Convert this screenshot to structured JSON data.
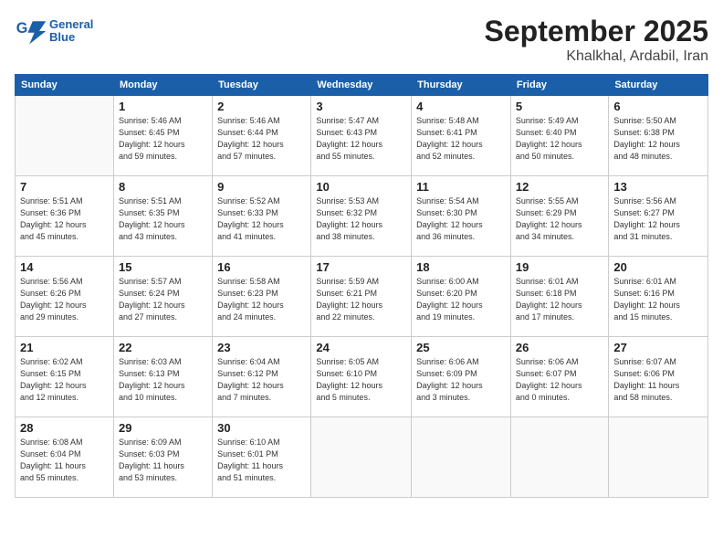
{
  "logo": {
    "text_general": "General",
    "text_blue": "Blue"
  },
  "header": {
    "month": "September 2025",
    "location": "Khalkhal, Ardabil, Iran"
  },
  "weekdays": [
    "Sunday",
    "Monday",
    "Tuesday",
    "Wednesday",
    "Thursday",
    "Friday",
    "Saturday"
  ],
  "weeks": [
    [
      {
        "day": "",
        "details": ""
      },
      {
        "day": "1",
        "details": "Sunrise: 5:46 AM\nSunset: 6:45 PM\nDaylight: 12 hours\nand 59 minutes."
      },
      {
        "day": "2",
        "details": "Sunrise: 5:46 AM\nSunset: 6:44 PM\nDaylight: 12 hours\nand 57 minutes."
      },
      {
        "day": "3",
        "details": "Sunrise: 5:47 AM\nSunset: 6:43 PM\nDaylight: 12 hours\nand 55 minutes."
      },
      {
        "day": "4",
        "details": "Sunrise: 5:48 AM\nSunset: 6:41 PM\nDaylight: 12 hours\nand 52 minutes."
      },
      {
        "day": "5",
        "details": "Sunrise: 5:49 AM\nSunset: 6:40 PM\nDaylight: 12 hours\nand 50 minutes."
      },
      {
        "day": "6",
        "details": "Sunrise: 5:50 AM\nSunset: 6:38 PM\nDaylight: 12 hours\nand 48 minutes."
      }
    ],
    [
      {
        "day": "7",
        "details": "Sunrise: 5:51 AM\nSunset: 6:36 PM\nDaylight: 12 hours\nand 45 minutes."
      },
      {
        "day": "8",
        "details": "Sunrise: 5:51 AM\nSunset: 6:35 PM\nDaylight: 12 hours\nand 43 minutes."
      },
      {
        "day": "9",
        "details": "Sunrise: 5:52 AM\nSunset: 6:33 PM\nDaylight: 12 hours\nand 41 minutes."
      },
      {
        "day": "10",
        "details": "Sunrise: 5:53 AM\nSunset: 6:32 PM\nDaylight: 12 hours\nand 38 minutes."
      },
      {
        "day": "11",
        "details": "Sunrise: 5:54 AM\nSunset: 6:30 PM\nDaylight: 12 hours\nand 36 minutes."
      },
      {
        "day": "12",
        "details": "Sunrise: 5:55 AM\nSunset: 6:29 PM\nDaylight: 12 hours\nand 34 minutes."
      },
      {
        "day": "13",
        "details": "Sunrise: 5:56 AM\nSunset: 6:27 PM\nDaylight: 12 hours\nand 31 minutes."
      }
    ],
    [
      {
        "day": "14",
        "details": "Sunrise: 5:56 AM\nSunset: 6:26 PM\nDaylight: 12 hours\nand 29 minutes."
      },
      {
        "day": "15",
        "details": "Sunrise: 5:57 AM\nSunset: 6:24 PM\nDaylight: 12 hours\nand 27 minutes."
      },
      {
        "day": "16",
        "details": "Sunrise: 5:58 AM\nSunset: 6:23 PM\nDaylight: 12 hours\nand 24 minutes."
      },
      {
        "day": "17",
        "details": "Sunrise: 5:59 AM\nSunset: 6:21 PM\nDaylight: 12 hours\nand 22 minutes."
      },
      {
        "day": "18",
        "details": "Sunrise: 6:00 AM\nSunset: 6:20 PM\nDaylight: 12 hours\nand 19 minutes."
      },
      {
        "day": "19",
        "details": "Sunrise: 6:01 AM\nSunset: 6:18 PM\nDaylight: 12 hours\nand 17 minutes."
      },
      {
        "day": "20",
        "details": "Sunrise: 6:01 AM\nSunset: 6:16 PM\nDaylight: 12 hours\nand 15 minutes."
      }
    ],
    [
      {
        "day": "21",
        "details": "Sunrise: 6:02 AM\nSunset: 6:15 PM\nDaylight: 12 hours\nand 12 minutes."
      },
      {
        "day": "22",
        "details": "Sunrise: 6:03 AM\nSunset: 6:13 PM\nDaylight: 12 hours\nand 10 minutes."
      },
      {
        "day": "23",
        "details": "Sunrise: 6:04 AM\nSunset: 6:12 PM\nDaylight: 12 hours\nand 7 minutes."
      },
      {
        "day": "24",
        "details": "Sunrise: 6:05 AM\nSunset: 6:10 PM\nDaylight: 12 hours\nand 5 minutes."
      },
      {
        "day": "25",
        "details": "Sunrise: 6:06 AM\nSunset: 6:09 PM\nDaylight: 12 hours\nand 3 minutes."
      },
      {
        "day": "26",
        "details": "Sunrise: 6:06 AM\nSunset: 6:07 PM\nDaylight: 12 hours\nand 0 minutes."
      },
      {
        "day": "27",
        "details": "Sunrise: 6:07 AM\nSunset: 6:06 PM\nDaylight: 11 hours\nand 58 minutes."
      }
    ],
    [
      {
        "day": "28",
        "details": "Sunrise: 6:08 AM\nSunset: 6:04 PM\nDaylight: 11 hours\nand 55 minutes."
      },
      {
        "day": "29",
        "details": "Sunrise: 6:09 AM\nSunset: 6:03 PM\nDaylight: 11 hours\nand 53 minutes."
      },
      {
        "day": "30",
        "details": "Sunrise: 6:10 AM\nSunset: 6:01 PM\nDaylight: 11 hours\nand 51 minutes."
      },
      {
        "day": "",
        "details": ""
      },
      {
        "day": "",
        "details": ""
      },
      {
        "day": "",
        "details": ""
      },
      {
        "day": "",
        "details": ""
      }
    ]
  ]
}
